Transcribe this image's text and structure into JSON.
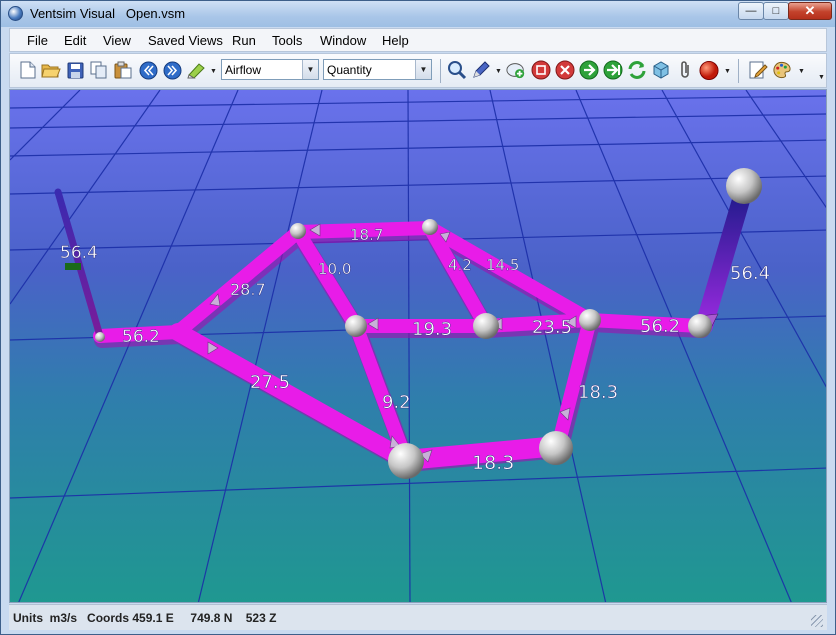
{
  "window": {
    "title": "Ventsim Visual   Open.vsm",
    "minimize_label": "—",
    "maximize_label": "□",
    "close_label": "✕"
  },
  "menu": [
    "File",
    "Edit",
    "View",
    "Saved Views",
    "Run",
    "Tools",
    "Window",
    "Help"
  ],
  "toolbar": {
    "display_select": "Airflow",
    "value_select": "Quantity",
    "colors": {
      "nav": "#2f6cc8",
      "stop": "#d23a3a",
      "go": "#2ea23a",
      "record": "#e02010"
    }
  },
  "model": {
    "colors": {
      "airway": "#e81ce8",
      "airway_shade": "#a012b0",
      "shaft_dark": "#241a8c",
      "shaft_light": "#8a2ad8",
      "node": "#d9d9d9",
      "sky": "#5a6ae0",
      "floor": "#238c96",
      "grid": "#1a2fa0",
      "label": "#ffffff"
    },
    "labels": [
      "56.4",
      "56.2",
      "28.7",
      "18.7",
      "10.0",
      "4.2",
      "14.5",
      "19.3",
      "23.5",
      "56.2",
      "56.4",
      "27.5",
      "9.2",
      "18.3",
      "18.3"
    ]
  },
  "status": {
    "text": "Units  m3/s   Coords 459.1 E     749.8 N    523 Z"
  }
}
